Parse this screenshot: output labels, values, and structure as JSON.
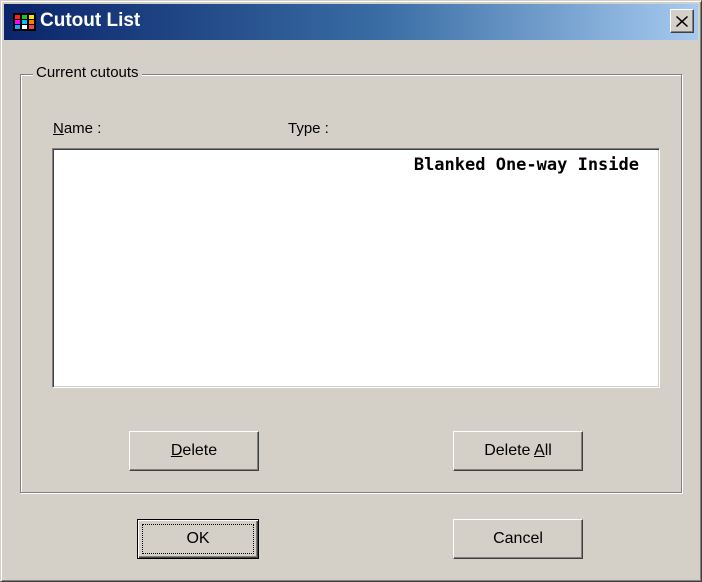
{
  "window": {
    "title": "Cutout List"
  },
  "group": {
    "label": "Current cutouts"
  },
  "columns": {
    "name_prefix": "",
    "name_mnemonic": "N",
    "name_rest": "ame :",
    "type_label": "Type :"
  },
  "list": {
    "rows": [
      {
        "name": "",
        "type": "Blanked One-way Inside"
      }
    ]
  },
  "buttons": {
    "delete_mnemonic": "D",
    "delete_rest": "elete",
    "delete_all_prefix": "Delete ",
    "delete_all_mnemonic": "A",
    "delete_all_rest": "ll",
    "ok_label": "OK",
    "cancel_label": "Cancel"
  },
  "icons": {
    "app": "app-grid-icon",
    "close": "close-icon"
  },
  "colors": {
    "titlebar_start": "#0a246a",
    "titlebar_end": "#a6caf0",
    "face": "#d4d0c8"
  }
}
